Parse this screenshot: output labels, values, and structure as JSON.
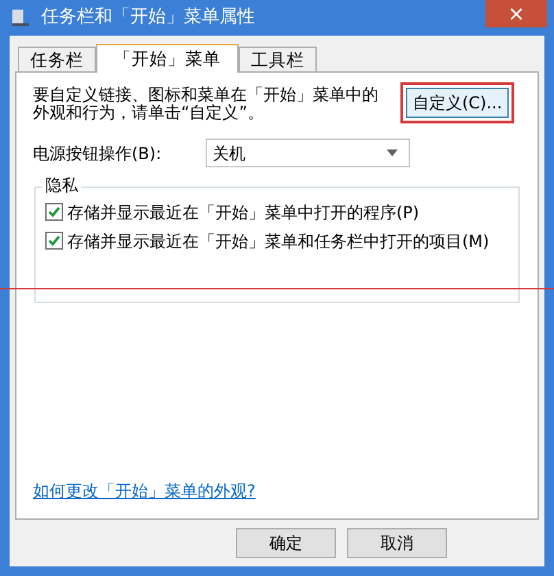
{
  "window": {
    "title": "任务栏和「开始」菜单属性",
    "close": "×"
  },
  "tabs": [
    {
      "label": "任务栏",
      "selected": false
    },
    {
      "label": "「开始」菜单",
      "selected": true
    },
    {
      "label": "工具栏",
      "selected": false
    }
  ],
  "intro": {
    "text": "要自定义链接、图标和菜单在「开始」菜单中的外观和行为，请单击“自定义”。",
    "button": "自定义(C)...",
    "highlighted": true
  },
  "power": {
    "label": "电源按钮操作(B):",
    "value": "关机"
  },
  "privacy": {
    "title": "隐私",
    "options": [
      {
        "label": "存储并显示最近在「开始」菜单中打开的程序(P)",
        "checked": true
      },
      {
        "label": "存储并显示最近在「开始」菜单和任务栏中打开的项目(M)",
        "checked": true
      }
    ]
  },
  "link": "如何更改「开始」菜单的外观?",
  "buttons": [
    "确定",
    "取消"
  ]
}
